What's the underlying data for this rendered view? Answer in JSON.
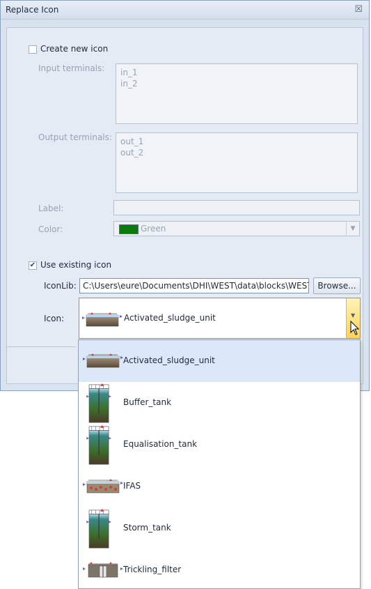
{
  "dialog": {
    "title": "Replace Icon",
    "close_glyph": "☒"
  },
  "create_new": {
    "label": "Create new icon",
    "checked": false,
    "input_terminals_label": "Input terminals:",
    "input_terminals": [
      "in_1",
      "in_2"
    ],
    "output_terminals_label": "Output terminals:",
    "output_terminals": [
      "out_1",
      "out_2"
    ],
    "label_label": "Label:",
    "label_value": "",
    "color_label": "Color:",
    "color_value": "Green",
    "color_hex": "#0a7a0a"
  },
  "use_existing": {
    "label": "Use existing icon",
    "checked": true,
    "iconlib_label": "IconLib:",
    "iconlib_path": "C:\\Users\\eure\\Documents\\DHI\\WEST\\data\\blocks\\WEST",
    "browse_label": "Browse...",
    "icon_label": "Icon:",
    "icon_selected": "Activated_sludge_unit"
  },
  "dropdown": {
    "items": [
      {
        "name": "Activated_sludge_unit",
        "icon": "activated-sludge-thumbnail",
        "selected": true
      },
      {
        "name": "Buffer_tank",
        "icon": "tank-thumbnail",
        "selected": false
      },
      {
        "name": "Equalisation_tank",
        "icon": "tank-thumbnail",
        "selected": false
      },
      {
        "name": "IFAS",
        "icon": "ifas-thumbnail",
        "selected": false
      },
      {
        "name": "Storm_tank",
        "icon": "tank-thumbnail",
        "selected": false
      },
      {
        "name": "Trickling_filter",
        "icon": "trickling-filter-thumbnail",
        "selected": false
      }
    ]
  }
}
